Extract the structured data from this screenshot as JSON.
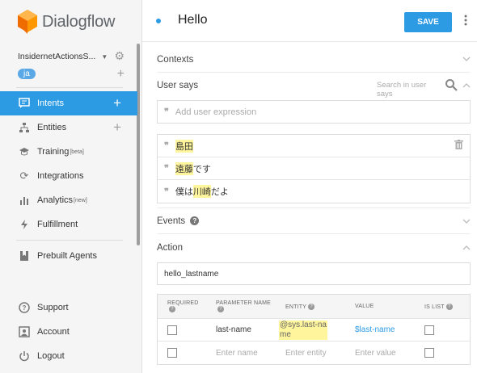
{
  "app": {
    "name": "Dialogflow"
  },
  "sidebar": {
    "agent_name": "InsidernetActionsS...",
    "language": "ja",
    "nav": [
      {
        "label": "Intents",
        "icon": "chat-icon",
        "active": true,
        "has_plus": true
      },
      {
        "label": "Entities",
        "icon": "hierarchy-icon",
        "has_plus": true
      },
      {
        "label": "Training",
        "sup": "[beta]",
        "icon": "graduation-cap-icon"
      },
      {
        "label": "Integrations",
        "icon": "sync-icon"
      },
      {
        "label": "Analytics",
        "sup": "[new]",
        "icon": "bar-chart-icon"
      },
      {
        "label": "Fulfillment",
        "icon": "lightning-icon"
      },
      {
        "label": "Prebuilt Agents",
        "icon": "bookmark-icon"
      },
      {
        "label": "Support",
        "icon": "help-circle-icon"
      },
      {
        "label": "Account",
        "icon": "account-box-icon"
      },
      {
        "label": "Logout",
        "icon": "power-icon"
      }
    ]
  },
  "header": {
    "title": "Hello",
    "save_label": "SAVE"
  },
  "sections": {
    "contexts": "Contexts",
    "user_says": "User says",
    "search_placeholder": "Search in user says",
    "add_expression_placeholder": "Add user expression",
    "events": "Events",
    "action": "Action"
  },
  "expressions": [
    {
      "highlight": "島田",
      "rest": ""
    },
    {
      "highlight": "遠藤",
      "rest": "です"
    },
    {
      "pre": "僕は",
      "highlight": "川崎",
      "rest": "だよ"
    }
  ],
  "action": {
    "value": "hello_lastname"
  },
  "parameters": {
    "headers": [
      "REQUIRED",
      "PARAMETER NAME",
      "ENTITY",
      "VALUE",
      "IS LIST"
    ],
    "rows": [
      {
        "name": "last-name",
        "entity": "@sys.last-name",
        "value": "$last-name"
      }
    ],
    "empty_row": {
      "name_placeholder": "Enter name",
      "entity_placeholder": "Enter entity",
      "value_placeholder": "Enter value"
    }
  },
  "colors": {
    "accent": "#2d9be3",
    "highlight": "#fff59d"
  }
}
